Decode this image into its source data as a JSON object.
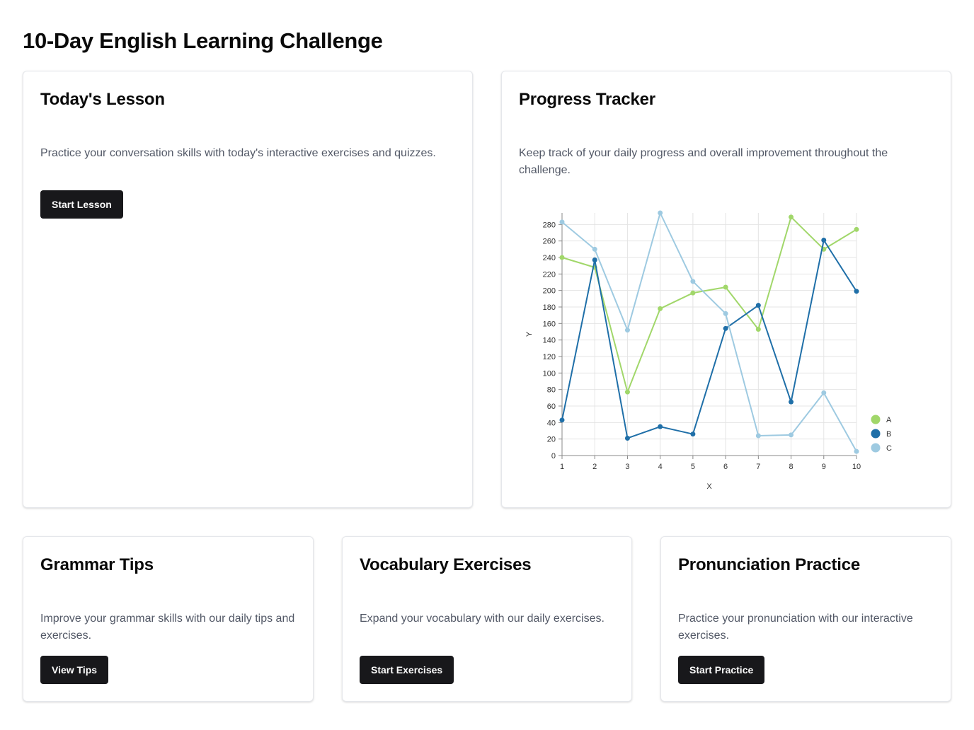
{
  "page": {
    "title": "10-Day English Learning Challenge"
  },
  "cards": {
    "lesson": {
      "title": "Today's Lesson",
      "description": "Practice your conversation skills with today's interactive exercises and quizzes.",
      "button": "Start Lesson"
    },
    "progress": {
      "title": "Progress Tracker",
      "description": "Keep track of your daily progress and overall improvement throughout the challenge."
    },
    "grammar": {
      "title": "Grammar Tips",
      "description": "Improve your grammar skills with our daily tips and exercises.",
      "button": "View Tips"
    },
    "vocab": {
      "title": "Vocabulary Exercises",
      "description": "Expand your vocabulary with our daily exercises.",
      "button": "Start Exercises"
    },
    "pron": {
      "title": "Pronunciation Practice",
      "description": "Practice your pronunciation with our interactive exercises.",
      "button": "Start Practice"
    }
  },
  "chart_data": {
    "type": "line",
    "x": [
      1,
      2,
      3,
      4,
      5,
      6,
      7,
      8,
      9,
      10
    ],
    "xlabel": "X",
    "ylabel": "Y",
    "xlim": [
      1,
      10
    ],
    "ylim": [
      0,
      294
    ],
    "yticks": [
      0,
      20,
      40,
      60,
      80,
      100,
      120,
      140,
      160,
      180,
      200,
      220,
      240,
      260,
      280
    ],
    "grid": true,
    "legend_position": "bottom-right",
    "series": [
      {
        "name": "A",
        "color": "#a1d76a",
        "values": [
          240,
          228,
          77,
          178,
          197,
          204,
          153,
          289,
          250,
          274
        ]
      },
      {
        "name": "B",
        "color": "#1f6fa8",
        "values": [
          43,
          237,
          21,
          35,
          26,
          154,
          182,
          65,
          261,
          199
        ]
      },
      {
        "name": "C",
        "color": "#9ecae1",
        "values": [
          283,
          250,
          152,
          294,
          211,
          172,
          24,
          25,
          76,
          5
        ]
      }
    ]
  }
}
